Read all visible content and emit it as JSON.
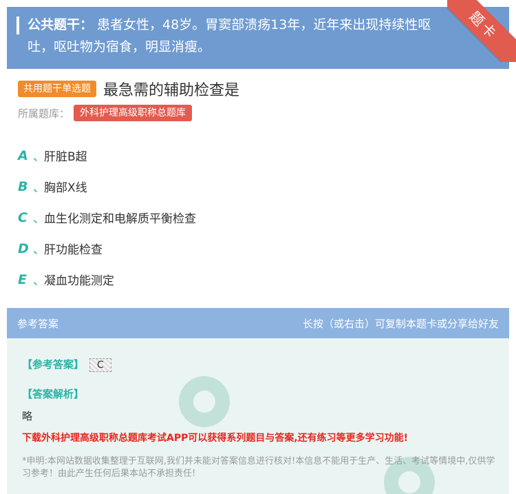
{
  "stem": {
    "label": "公共题干：",
    "text": "患者女性，48岁。胃窦部溃疡13年，近年来出现持续性呕吐，呕吐物为宿食，明显消瘦。"
  },
  "ribbon": {
    "text": "题卡"
  },
  "question": {
    "type_tag": "共用题干单选题",
    "title": "最急需的辅助检查是",
    "bank_label": "所属题库：",
    "bank_name": "外科护理高级职称总题库"
  },
  "options": [
    {
      "letter": "A",
      "sep": "、",
      "text": "肝脏B超"
    },
    {
      "letter": "B",
      "sep": "、",
      "text": "胸部X线"
    },
    {
      "letter": "C",
      "sep": "、",
      "text": "血生化测定和电解质平衡检查"
    },
    {
      "letter": "D",
      "sep": "、",
      "text": "肝功能检查"
    },
    {
      "letter": "E",
      "sep": "、",
      "text": "凝血功能测定"
    }
  ],
  "answer_section": {
    "header_left": "参考答案",
    "header_right": "长按（或右击）可复制本题卡或分享给好友",
    "answer_tag": "【参考答案】",
    "answer_value": "C",
    "analysis_tag": "【答案解析】",
    "analysis_text": "略",
    "promo": "下载外科护理高级职称总题库考试APP可以获得系列题目与答案,还有练习等更多学习功能!",
    "disclaimer": "*申明:本网站数据收集整理于互联网,我们并未能对答案信息进行核对!本信息不能用于生产、生活、考试等情境中,仅供学习参考！由此产生任何后果本站不承担责任!"
  },
  "colors": {
    "stem_bg": "#6f9bd0",
    "ribbon": "#e25b4f",
    "type_tag": "#f08c2c",
    "bank_tag": "#e25b4f",
    "option_letter": "#2bb3a7",
    "answer_header": "#8db3e0",
    "answer_bg": "#eaf5f3",
    "promo": "#e8261e"
  }
}
